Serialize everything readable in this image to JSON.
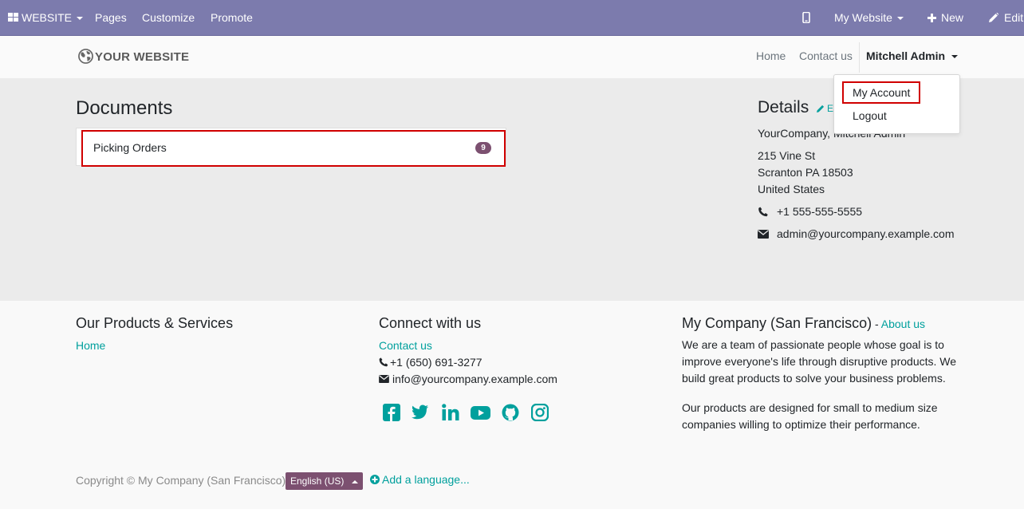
{
  "adminbar": {
    "website_menu": "WEBSITE",
    "pages": "Pages",
    "customize": "Customize",
    "promote": "Promote",
    "site_selector": "My Website",
    "new_label": "New",
    "edit_label": "Edit"
  },
  "header": {
    "logo_text": "YOUR WEBSITE",
    "nav": [
      "Home",
      "Contact us"
    ],
    "user_name": "Mitchell Admin"
  },
  "dropdown": {
    "items": [
      "My Account",
      "Logout"
    ]
  },
  "documents": {
    "title": "Documents",
    "items": [
      {
        "label": "Picking Orders",
        "count": "9"
      }
    ]
  },
  "details": {
    "title": "Details",
    "edit_label": "Edit",
    "company_line": "YourCompany, Mitchell Admin",
    "street": "215 Vine St",
    "city": "Scranton PA 18503",
    "country": "United States",
    "phone": "+1 555-555-5555",
    "email": "admin@yourcompany.example.com"
  },
  "footer": {
    "col1": {
      "title": "Our Products & Services",
      "link": "Home"
    },
    "col2": {
      "title": "Connect with us",
      "link": "Contact us",
      "phone": "+1 (650) 691-3277",
      "email": "info@yourcompany.example.com"
    },
    "col3": {
      "title": "My Company (San Francisco)",
      "sep": " - ",
      "link": "About us",
      "p1": "We are a team of passionate people whose goal is to improve everyone's life through disruptive products. We build great products to solve your business problems.",
      "p2": "Our products are designed for small to medium size companies willing to optimize their performance."
    },
    "copyright": "Copyright © My Company (San Francisco)",
    "language": "English (US)",
    "add_language": "Add a language..."
  },
  "colors": {
    "adminbar": "#7c7bad",
    "accent": "#00a09d",
    "badge": "#7c5070",
    "highlight_border": "#d00000"
  },
  "icons": {
    "social": [
      "facebook-icon",
      "twitter-icon",
      "linkedin-icon",
      "youtube-icon",
      "github-icon",
      "instagram-icon"
    ]
  }
}
